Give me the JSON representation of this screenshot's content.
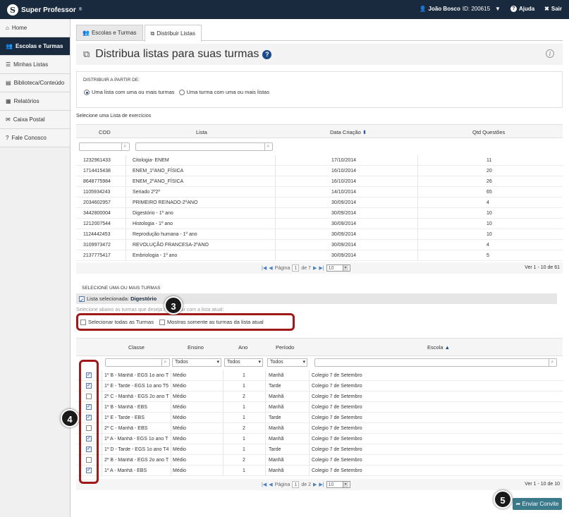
{
  "topbar": {
    "logo_text": "Super Professor",
    "logo_reg": "®",
    "user_name": "João Bosco",
    "user_id_label": "ID: 200615",
    "help_label": "Ajuda",
    "exit_label": "Sair"
  },
  "sidebar": {
    "items": [
      {
        "label": "Home",
        "icon": "home-icon"
      },
      {
        "label": "Escolas e Turmas",
        "icon": "users-icon"
      },
      {
        "label": "Minhas Listas",
        "icon": "list-icon"
      },
      {
        "label": "Biblioteca/Conteúdo",
        "icon": "book-icon"
      },
      {
        "label": "Relatórios",
        "icon": "chart-icon"
      },
      {
        "label": "Caixa Postal",
        "icon": "envelope-icon"
      },
      {
        "label": "Fale Conosco",
        "icon": "question-icon"
      }
    ]
  },
  "tabs": [
    {
      "label": "Escolas e Turmas"
    },
    {
      "label": "Distribuir Listas"
    }
  ],
  "page_title": "Distribua listas para suas turmas",
  "distribute": {
    "heading": "DISTRIBUIR A PARTIR DE:",
    "option1": "Uma lista com uma ou mais turmas",
    "option2": "Uma turma com uma ou mais listas"
  },
  "lists": {
    "section_title": "Selecione uma Lista de exercícios",
    "headers": [
      "COD",
      "Lista",
      "Data Criação",
      "Qtd Questões"
    ],
    "rows": [
      [
        "1232961433",
        "Citologia- ENEM",
        "17/10/2014",
        "11"
      ],
      [
        "1714415438",
        "ENEM_1ºANO_FÍSICA",
        "16/10/2014",
        "20"
      ],
      [
        "8648775984",
        "ENEM_2ºANO_FÍSICA",
        "16/10/2014",
        "26"
      ],
      [
        "1105934243",
        "Seriado 2º2º",
        "14/10/2014",
        "65"
      ],
      [
        "2034602957",
        "PRIMEIRO REINADO-2ºANO",
        "30/09/2014",
        "4"
      ],
      [
        "3442800004",
        "Digestório - 1º ano",
        "30/09/2014",
        "10"
      ],
      [
        "1212007544",
        "Histologia - 1º ano",
        "30/09/2014",
        "10"
      ],
      [
        "1124442453",
        "Reprodução humana - 1º ano",
        "30/09/2014",
        "10"
      ],
      [
        "3109973472",
        "REVOLUÇÃO FRANCESA-2ºANO",
        "30/09/2014",
        "4"
      ],
      [
        "2137775417",
        "Embriologia - 1º ano",
        "30/09/2014",
        "5"
      ]
    ],
    "pager": {
      "page_label": "Página",
      "page": "1",
      "of_label": "de 7",
      "per_page": "10",
      "summary": "Ver 1 - 10 de 61"
    }
  },
  "turmas": {
    "heading": "SELECIONE UMA OU MAIS TURMAS",
    "selected_label": "Lista selecionada:",
    "selected_value": "Digestório",
    "hint": "Selecione abaixo as turmas que deseja relacionar com a lista atual:",
    "select_all": "Selecionar todas as Turmas",
    "show_current": "Mostras somente as turmas da lista atual",
    "headers": [
      "Classe",
      "Ensino",
      "Ano",
      "Período",
      "Escola"
    ],
    "filter_default": "Todos",
    "rows": [
      {
        "checked": true,
        "classe": "1º B - Manhã - EGS 1o ano T",
        "ensino": "Médio",
        "ano": "1",
        "periodo": "Manhã",
        "escola": "Colegio 7 de Setembro"
      },
      {
        "checked": true,
        "classe": "1º E - Tarde - EGS 1o ano T5",
        "ensino": "Médio",
        "ano": "1",
        "periodo": "Tarde",
        "escola": "Colegio 7 de Setembro"
      },
      {
        "checked": false,
        "classe": "2º C - Manhã - EGS 2o ano T",
        "ensino": "Médio",
        "ano": "2",
        "periodo": "Manhã",
        "escola": "Colegio 7 de Setembro"
      },
      {
        "checked": true,
        "classe": "1º B - Manhã - EBS",
        "ensino": "Médio",
        "ano": "1",
        "periodo": "Manhã",
        "escola": "Colegio 7 de Setembro"
      },
      {
        "checked": true,
        "classe": "1º E - Tarde - EBS",
        "ensino": "Médio",
        "ano": "1",
        "periodo": "Tarde",
        "escola": "Colegio 7 de Setembro"
      },
      {
        "checked": false,
        "classe": "2º C - Manhã - EBS",
        "ensino": "Médio",
        "ano": "2",
        "periodo": "Manhã",
        "escola": "Colegio 7 de Setembro"
      },
      {
        "checked": true,
        "classe": "1º A - Manhã - EGS 1o ano T",
        "ensino": "Médio",
        "ano": "1",
        "periodo": "Manhã",
        "escola": "Colegio 7 de Setembro"
      },
      {
        "checked": true,
        "classe": "1º D - Tarde - EGS 1o ano T4",
        "ensino": "Médio",
        "ano": "1",
        "periodo": "Tarde",
        "escola": "Colegio 7 de Setembro"
      },
      {
        "checked": false,
        "classe": "2º B - Manhã - EGS 2o ano T",
        "ensino": "Médio",
        "ano": "2",
        "periodo": "Manhã",
        "escola": "Colegio 7 de Setembro"
      },
      {
        "checked": true,
        "classe": "1º A - Manhã - EBS",
        "ensino": "Médio",
        "ano": "1",
        "periodo": "Manhã",
        "escola": "Colegio 7 de Setembro"
      }
    ],
    "pager": {
      "page_label": "Página",
      "page": "1",
      "of_label": "de 2",
      "per_page": "10",
      "summary": "Ver 1 - 10 de 10"
    }
  },
  "send_button": "Enviar Convite",
  "badges": [
    "3",
    "4",
    "5"
  ],
  "colors": {
    "topbar": "#1a2a3e",
    "accent": "#1a4a8a",
    "callout": "#a01818",
    "send": "#3a7a8a"
  }
}
